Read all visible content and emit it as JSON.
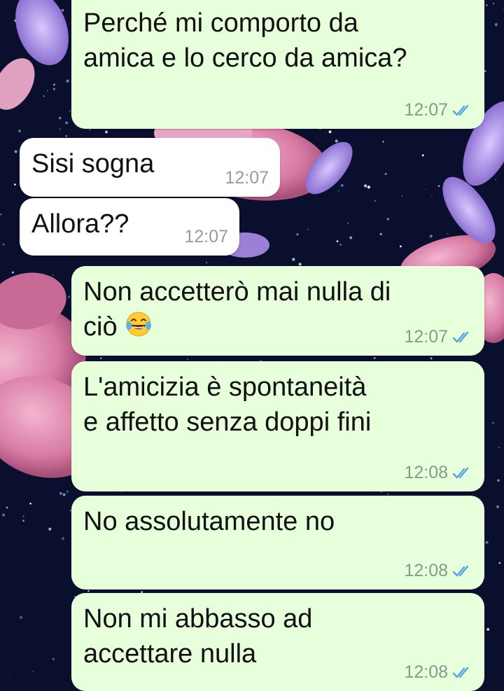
{
  "colors": {
    "outgoing_bubble": "#e7ffdb",
    "incoming_bubble": "#ffffff",
    "read_ticks": "#4fa6e0",
    "wallpaper": "#0b0f2e"
  },
  "messages": [
    {
      "direction": "out",
      "text": "Perché mi comporto da\namica e lo cerco da amica?",
      "time": "12:07",
      "status_icon": "double-check-read-icon"
    },
    {
      "direction": "in",
      "text": "Sisi sogna",
      "time": "12:07"
    },
    {
      "direction": "in",
      "text": "Allora??",
      "time": "12:07"
    },
    {
      "direction": "out",
      "text": "Non accetterò mai nulla di\nciò",
      "emoji": "face-with-tears-of-joy",
      "time": "12:07",
      "status_icon": "double-check-read-icon"
    },
    {
      "direction": "out",
      "text": "L'amicizia è spontaneità\ne affetto senza doppi fini",
      "time": "12:08",
      "status_icon": "double-check-read-icon"
    },
    {
      "direction": "out",
      "text": "No assolutamente no",
      "time": "12:08",
      "status_icon": "double-check-read-icon"
    },
    {
      "direction": "out",
      "text": "Non mi abbasso ad\naccettare nulla",
      "time": "12:08",
      "status_icon": "double-check-read-icon"
    }
  ]
}
